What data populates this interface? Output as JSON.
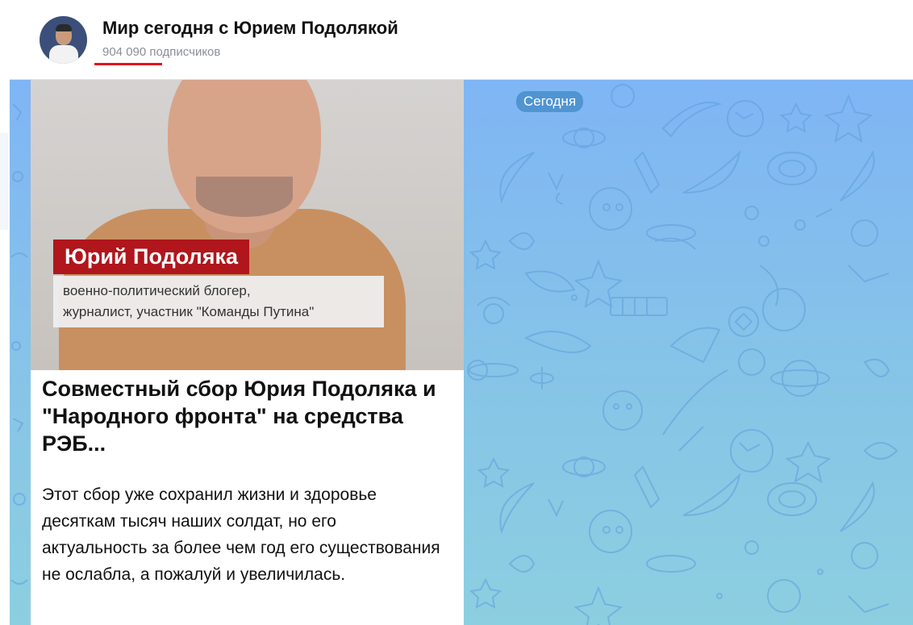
{
  "header": {
    "channel_title": "Мир сегодня с Юрием Подолякой",
    "subscriber_count": "904 090",
    "subscriber_label": "подписчиков",
    "avatar_icon": "channel-avatar"
  },
  "chat": {
    "date_pill": "Сегодня",
    "background_colors": [
      "#7fb5f5",
      "#8ccfe0"
    ]
  },
  "post": {
    "media": {
      "name_caption": "Юрий Подоляка",
      "desc_line1": "военно-политический блогер,",
      "desc_line2": "журналист, участник \"Команды Путина\"",
      "accent_color": "#b0161c"
    },
    "title": "Совместный сбор Юрия Подоляка и \"Народного фронта\" на средства РЭБ...",
    "text": "Этот сбор уже сохранил жизни и здоровье десяткам тысяч наших солдат, но его актуальность за более чем год его существования не ослабла, а пожалуй и увеличилась."
  }
}
